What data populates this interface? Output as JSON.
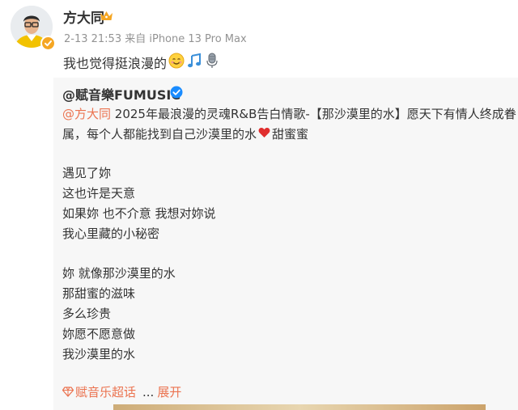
{
  "post": {
    "author_name": "方大同",
    "meta": "2-13 21:53  来自 iPhone 13 Pro Max",
    "text": "我也觉得挺浪漫的",
    "text_emojis": [
      "smile-emoji",
      "music-note-emoji",
      "microphone-emoji"
    ]
  },
  "repost": {
    "author": "@赋音樂FUMUSIC",
    "mention": "@方大同",
    "intro_line1": " 2025年最浪漫的灵魂R&B告白情歌-【那沙漠里的水】愿天下有情人终成眷",
    "intro_line2a": "属，每个人都能找到自己沙漠里的水",
    "intro_line2b": "甜蜜蜜",
    "stanza1": [
      "遇见了妳",
      "这也许是天意",
      "如果妳  也不介意  我想对妳说",
      "我心里藏的小秘密"
    ],
    "stanza2": [
      "妳  就像那沙漠里的水",
      "那甜蜜的滋味",
      "多么珍贵",
      "妳愿不愿意做",
      "我沙漠里的水"
    ],
    "topic_link": "赋音乐超话",
    "ellipsis": "...",
    "expand_label": "展开"
  },
  "colors": {
    "link": "#eb7350",
    "meta_text": "#939393",
    "repost_bg": "#f7f7f7",
    "heart": "#e02e2e",
    "verified_blue": "#1a8cff",
    "badge_orange": "#f5a623"
  }
}
